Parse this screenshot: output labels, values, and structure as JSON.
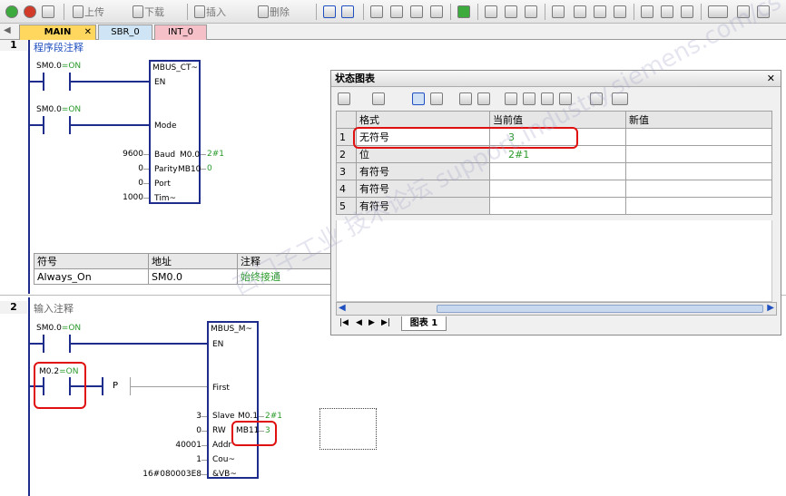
{
  "toolbar": {
    "upload_label": "上传",
    "download_label": "下载",
    "insert_label": "插入",
    "delete_label": "删除"
  },
  "tabs": [
    "MAIN",
    "SBR_0",
    "INT_0"
  ],
  "networks": [
    {
      "number": "1",
      "comment": "程序段注释",
      "contact1": {
        "address": "SM0.0",
        "state": "=ON"
      },
      "contact2": {
        "address": "SM0.0",
        "state": "=ON"
      },
      "block": {
        "name": "MBUS_CT~",
        "en": "EN",
        "mode": "Mode",
        "baud_in": "9600",
        "baud": "Baud",
        "baud_out_addr": "M0.0",
        "baud_out_val": "2#1",
        "parity_in": "0",
        "parity": "Parity",
        "parity_out_addr": "MB10",
        "parity_out_val": "0",
        "port_in": "0",
        "port": "Port",
        "tim_in": "1000",
        "tim": "Tim~"
      },
      "symbol_table": {
        "headers": [
          "符号",
          "地址",
          "注释"
        ],
        "row": [
          "Always_On",
          "SM0.0",
          "始终接通"
        ]
      }
    },
    {
      "number": "2",
      "comment": "输入注释",
      "contact1": {
        "address": "SM0.0",
        "state": "=ON"
      },
      "contact2": {
        "address": "M0.2",
        "state": "=ON"
      },
      "p_label": "P",
      "block": {
        "name": "MBUS_M~",
        "en": "EN",
        "first": "First",
        "slave_in": "3",
        "slave": "Slave",
        "slave_out_addr": "M0.1",
        "slave_out_val": "2#1",
        "rw_in": "0",
        "rw": "RW",
        "rw_out_addr": "MB11",
        "rw_out_val": "3",
        "addr_in": "40001",
        "addr": "Addr",
        "cou_in": "1",
        "cou": "Cou~",
        "vb_in": "16#080003E8",
        "vb": "&VB~"
      }
    }
  ],
  "status_chart": {
    "title": "状态图表",
    "headers": [
      "",
      "格式",
      "当前值",
      "新值"
    ],
    "rows": [
      {
        "no": "1",
        "format": "无符号",
        "current": "3",
        "new": ""
      },
      {
        "no": "2",
        "format": "位",
        "current": "2#1",
        "new": ""
      },
      {
        "no": "3",
        "format": "有符号",
        "current": "",
        "new": ""
      },
      {
        "no": "4",
        "format": "有符号",
        "current": "",
        "new": ""
      },
      {
        "no": "5",
        "format": "有符号",
        "current": "",
        "new": ""
      }
    ],
    "sheet_tab": "图表 1"
  },
  "watermark": "西门子工业 技术论坛 support.industry.siemens.com/cs",
  "colors": {
    "wire": "#1e2c8c",
    "on_state": "#2a9a2a",
    "highlight": "#e01010"
  }
}
